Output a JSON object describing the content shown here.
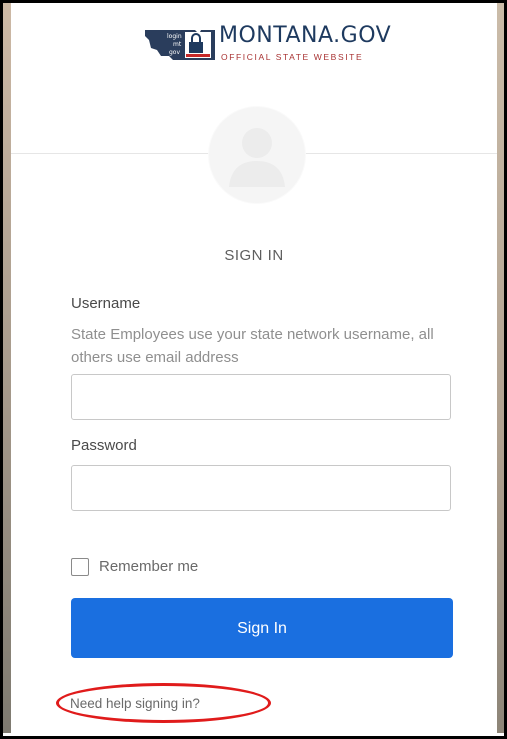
{
  "logo": {
    "title": "MONTANA.GOV",
    "subtitle": "OFFICIAL STATE WEBSITE",
    "badge_lines": [
      "login",
      "mt",
      "gov"
    ]
  },
  "avatar": {
    "icon": "user-avatar-icon"
  },
  "form": {
    "heading": "SIGN IN",
    "username_label": "Username",
    "username_hint": "State Employees use your state network username, all others use email address",
    "username_value": "",
    "password_label": "Password",
    "password_value": "",
    "remember_label": "Remember me",
    "remember_checked": false,
    "submit_label": "Sign In",
    "help_link": "Need help signing in?"
  },
  "colors": {
    "primary": "#1a6fe0",
    "annotation": "#e01b1b",
    "brand": "#1e3a5f"
  }
}
